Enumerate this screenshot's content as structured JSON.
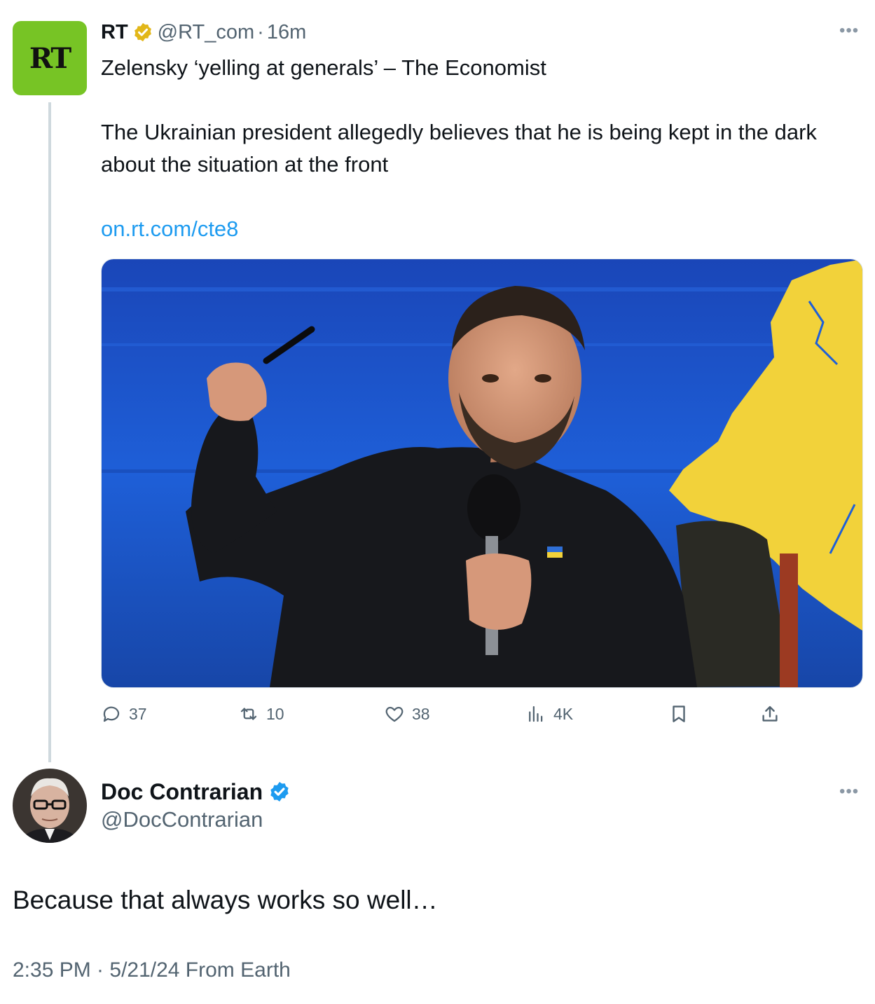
{
  "parent_tweet": {
    "avatar_logo": "RT",
    "name": "RT",
    "handle": "@RT_com",
    "separator": "·",
    "time": "16m",
    "headline": "Zelensky ‘yelling at generals’ – The Economist",
    "body": "The Ukrainian president allegedly believes that he is being kept in the dark about the situation at the front",
    "link": "on.rt.com/cte8",
    "more_icon": "more-horizontal-icon",
    "stats": {
      "replies": "37",
      "reposts": "10",
      "likes": "38",
      "views": "4K"
    },
    "colors": {
      "avatar_bg": "#77c425",
      "badge": "#e2b719",
      "link": "#1d9bf0"
    }
  },
  "reply_tweet": {
    "name": "Doc Contrarian",
    "handle": "@DocContrarian",
    "text": "Because that always works so well…",
    "timestamp": "2:35 PM · 5/21/24 From Earth",
    "more_icon": "more-horizontal-icon",
    "colors": {
      "badge": "#1d9bf0",
      "meta": "#536471"
    }
  }
}
